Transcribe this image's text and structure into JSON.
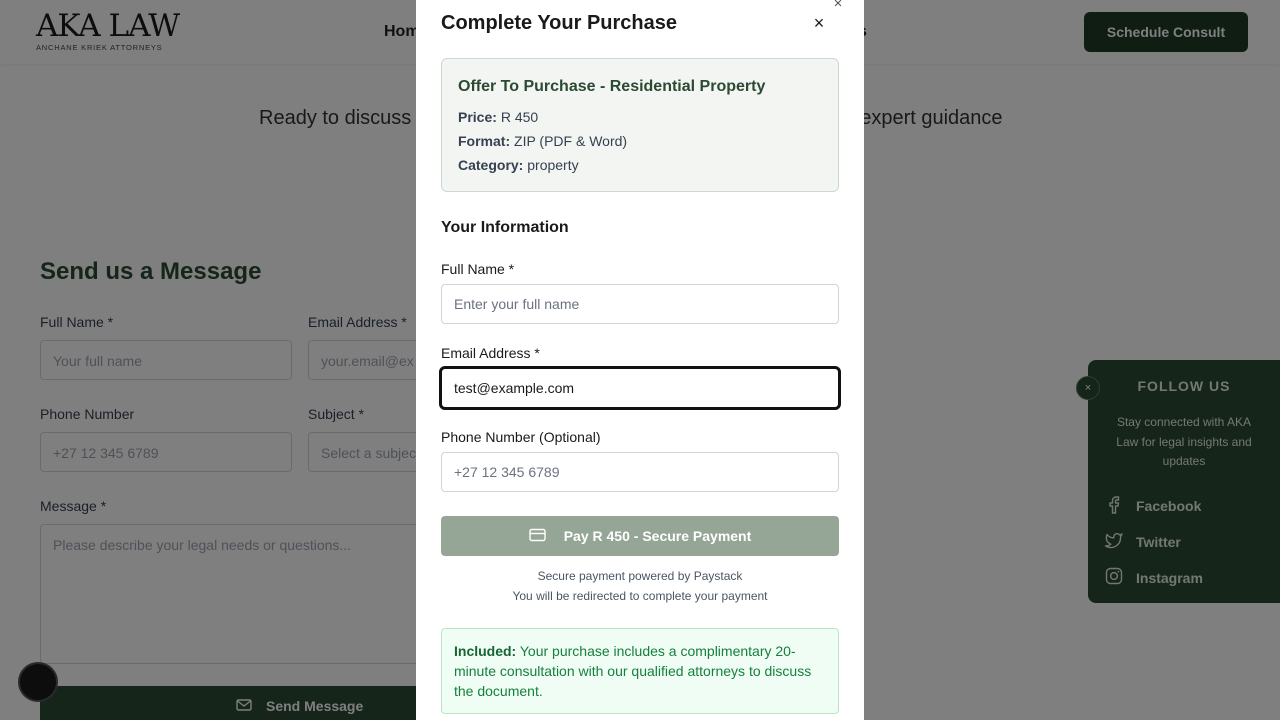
{
  "header": {
    "logo_main": "AKA LAW",
    "logo_sub": "ANCHANE KRIEK ATTORNEYS",
    "nav_home": "Hom",
    "nav_tail": "s",
    "consult_button": "Schedule Consult"
  },
  "hero": {
    "tagline_left": "Ready to discuss",
    "tagline_right": "r expert guidance"
  },
  "contact_form": {
    "title": "Send us a Message",
    "full_name_label": "Full Name *",
    "full_name_placeholder": "Your full name",
    "email_label": "Email Address *",
    "email_placeholder": "your.email@ex",
    "phone_label": "Phone Number",
    "phone_placeholder": "+27 12 345 6789",
    "subject_label": "Subject *",
    "subject_placeholder": "Select a subjec",
    "message_label": "Message *",
    "message_placeholder": "Please describe your legal needs or questions...",
    "send_button": "Send Message"
  },
  "follow": {
    "close": "×",
    "title": "FOLLOW US",
    "text": "Stay connected with AKA Law for legal insights and updates",
    "links": [
      "Facebook",
      "Twitter",
      "Instagram"
    ]
  },
  "modal": {
    "title": "Complete Your Purchase",
    "close": "×",
    "product": {
      "name": "Offer To Purchase - Residential Property",
      "price_label": "Price:",
      "price_value": "R 450",
      "format_label": "Format:",
      "format_value": "ZIP (PDF & Word)",
      "category_label": "Category:",
      "category_value": "property"
    },
    "section_title": "Your Information",
    "full_name_label": "Full Name *",
    "full_name_placeholder": "Enter your full name",
    "email_label": "Email Address *",
    "email_value": "test@example.com",
    "phone_label": "Phone Number (Optional)",
    "phone_placeholder": "+27 12 345 6789",
    "pay_button": "Pay R 450 - Secure Payment",
    "note_1": "Secure payment powered by Paystack",
    "note_2": "You will be redirected to complete your payment",
    "included_label": "Included:",
    "included_text": "Your purchase includes a complimentary 20-minute consultation with our qualified attorneys to discuss the document."
  },
  "colors": {
    "brand_green": "#2c4a33",
    "pay_button_disabled": "#95a596",
    "included_bg": "#f0fdf4"
  }
}
